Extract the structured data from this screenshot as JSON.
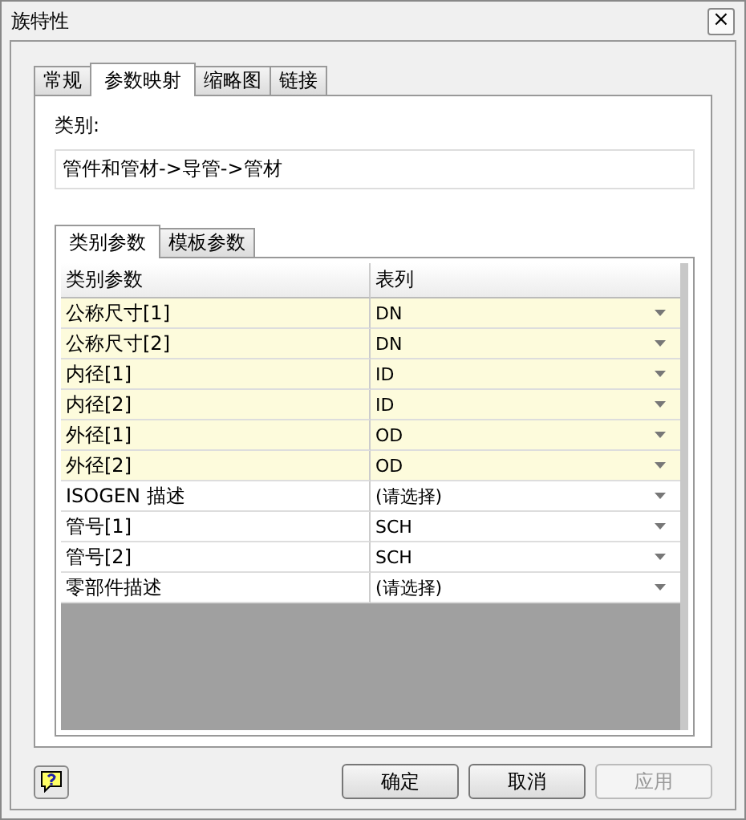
{
  "window": {
    "title": "族特性",
    "close": "×"
  },
  "tabs": [
    {
      "label": "常规",
      "selected": false
    },
    {
      "label": "参数映射",
      "selected": true
    },
    {
      "label": "缩略图",
      "selected": false
    },
    {
      "label": "链接",
      "selected": false
    }
  ],
  "category": {
    "label": "类别:",
    "value": "管件和管材->导管->管材"
  },
  "sub_tabs": [
    {
      "label": "类别参数",
      "selected": true
    },
    {
      "label": "模板参数",
      "selected": false
    }
  ],
  "table": {
    "columns": [
      "类别参数",
      "表列"
    ],
    "rows": [
      {
        "param": "公称尺寸[1]",
        "column": "DN",
        "highlighted": true
      },
      {
        "param": "公称尺寸[2]",
        "column": "DN",
        "highlighted": true
      },
      {
        "param": "内径[1]",
        "column": "ID",
        "highlighted": true
      },
      {
        "param": "内径[2]",
        "column": "ID",
        "highlighted": true
      },
      {
        "param": "外径[1]",
        "column": "OD",
        "highlighted": true
      },
      {
        "param": "外径[2]",
        "column": "OD",
        "highlighted": true
      },
      {
        "param": "ISOGEN 描述",
        "column": "(请选择)",
        "highlighted": false
      },
      {
        "param": "管号[1]",
        "column": "SCH",
        "highlighted": false
      },
      {
        "param": "管号[2]",
        "column": "SCH",
        "highlighted": false
      },
      {
        "param": "零部件描述",
        "column": "(请选择)",
        "highlighted": false
      }
    ]
  },
  "buttons": [
    {
      "label": "确定",
      "disabled": false
    },
    {
      "label": "取消",
      "disabled": false
    },
    {
      "label": "应用",
      "disabled": true
    }
  ]
}
